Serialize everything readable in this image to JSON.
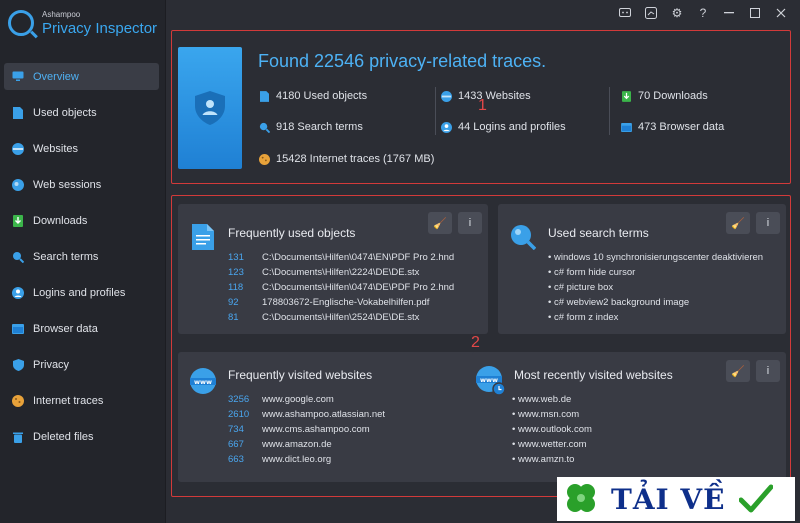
{
  "brand": {
    "company": "Ashampoo",
    "product": "Privacy Inspector"
  },
  "nav": [
    {
      "label": "Overview",
      "icon": "monitor-icon",
      "color": "#3aa0e8",
      "active": true
    },
    {
      "label": "Used objects",
      "icon": "document-icon",
      "color": "#3aa0e8"
    },
    {
      "label": "Websites",
      "icon": "www-icon",
      "color": "#3aa0e8"
    },
    {
      "label": "Web sessions",
      "icon": "globe-icon",
      "color": "#3aa0e8"
    },
    {
      "label": "Downloads",
      "icon": "download-icon",
      "color": "#3bb54a"
    },
    {
      "label": "Search terms",
      "icon": "search-icon",
      "color": "#3aa0e8"
    },
    {
      "label": "Logins and profiles",
      "icon": "user-icon",
      "color": "#3aa0e8"
    },
    {
      "label": "Browser data",
      "icon": "browser-icon",
      "color": "#3aa0e8"
    },
    {
      "label": "Privacy",
      "icon": "shield-icon",
      "color": "#3aa0e8"
    },
    {
      "label": "Internet traces",
      "icon": "cookie-icon",
      "color": "#e8a23a"
    },
    {
      "label": "Deleted files",
      "icon": "trash-icon",
      "color": "#3aa0e8"
    }
  ],
  "overview": {
    "title": "Found 22546 privacy-related traces.",
    "stats": {
      "used_objects": "4180 Used objects",
      "search_terms": "918 Search terms",
      "internet_traces": "15428 Internet traces  (1767 MB)",
      "websites": "1433 Websites",
      "logins": "44 Logins and profiles",
      "downloads": "70 Downloads",
      "browser_data": "473 Browser data"
    },
    "marker": "1"
  },
  "cards_marker": "2",
  "cards": {
    "objects": {
      "title": "Frequently used objects",
      "rows": [
        {
          "count": "131",
          "path": "C:\\Documents\\Hilfen\\0474\\EN\\PDF Pro 2.hnd"
        },
        {
          "count": "123",
          "path": "C:\\Documents\\Hilfen\\2224\\DE\\DE.stx"
        },
        {
          "count": "118",
          "path": "C:\\Documents\\Hilfen\\0474\\DE\\PDF Pro 2.hnd"
        },
        {
          "count": "92",
          "path": "178803672-Englische-Vokabelhilfen.pdf"
        },
        {
          "count": "81",
          "path": "C:\\Documents\\Hilfen\\2524\\DE\\DE.stx"
        }
      ]
    },
    "search": {
      "title": "Used search terms",
      "rows": [
        "windows 10 synchronisierungscenter deaktivieren",
        "c# form hide cursor",
        "c# picture box",
        "c# webview2 background image",
        "c# form z index"
      ]
    },
    "visited": {
      "title": "Frequently visited websites",
      "rows": [
        {
          "count": "3256",
          "site": "www.google.com"
        },
        {
          "count": "2610",
          "site": "www.ashampoo.atlassian.net"
        },
        {
          "count": "734",
          "site": "www.cms.ashampoo.com"
        },
        {
          "count": "667",
          "site": "www.amazon.de"
        },
        {
          "count": "663",
          "site": "www.dict.leo.org"
        }
      ]
    },
    "recent": {
      "title": "Most recently visited websites",
      "rows": [
        "www.web.de",
        "www.msn.com",
        "www.outlook.com",
        "www.wetter.com",
        "www.amzn.to"
      ]
    },
    "clean_icon": "broom-icon",
    "info_label": "i"
  },
  "watermark": {
    "text": "TẢI VỀ"
  },
  "colors": {
    "accent": "#3aa8f0",
    "highlight_border": "#d23a3a",
    "card_bg": "#393b44"
  }
}
